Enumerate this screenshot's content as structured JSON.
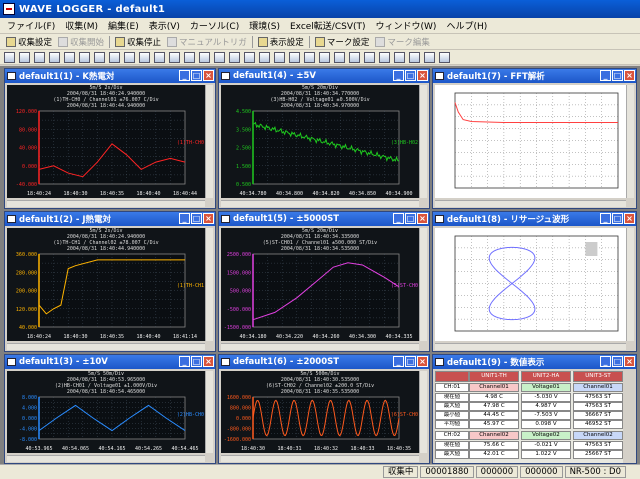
{
  "app": {
    "title": "WAVE LOGGER - default1"
  },
  "menu": [
    "ファイル(F)",
    "収集(M)",
    "編集(E)",
    "表示(V)",
    "カーソル(C)",
    "環境(S)",
    "Excel転送/CSV(T)",
    "ウィンドウ(W)",
    "ヘルプ(H)"
  ],
  "toolbar": [
    {
      "label": "収集設定",
      "enabled": true
    },
    {
      "label": "収集開始",
      "enabled": false
    },
    {
      "label": "収集停止",
      "enabled": true
    },
    {
      "label": "マニュアルトリガ",
      "enabled": false
    },
    {
      "label": "表示設定",
      "enabled": true
    },
    {
      "label": "マーク設定",
      "enabled": true
    },
    {
      "label": "マーク編集",
      "enabled": false
    }
  ],
  "windows": [
    {
      "title": "default1(1) - K熱電対",
      "kind": "trend",
      "color": "#ff2424",
      "header": [
        "5m/S  2s/Div",
        "2004/08/31 18:40:24.940000",
        "(1)TH-CH0 / Channel01 ±76.007 C/Div",
        "2004/08/31 18:40:44.940000"
      ],
      "xticks": [
        "18:40:24",
        "18:40:30",
        "18:40:35",
        "18:40:40",
        "18:40:44"
      ],
      "yticks": [
        "120.000",
        "80.000",
        "40.000",
        "0.000",
        "-40.000"
      ],
      "tag": "(1)TH-CH0"
    },
    {
      "title": "default1(4) - ±5V",
      "kind": "trend",
      "color": "#1fc81f",
      "header": [
        "5m/S  20m/Div",
        "2004/08/31 18:40:34.770000",
        "(3)HB-H02 / Voltage01 ±0.500V/Div",
        "2004/08/31 18:40:34.970000"
      ],
      "xticks": [
        "40:34.780",
        "40:34.800",
        "40:34.820",
        "40:34.850",
        "40:34.900"
      ],
      "yticks": [
        "4.500",
        "3.500",
        "2.500",
        "1.500",
        "0.500"
      ],
      "tag": "(3)HB-H02"
    },
    {
      "title": "default1(7) - FFT解析",
      "kind": "fft",
      "color": "#ff4040",
      "header": [],
      "xticks": [],
      "yticks": [],
      "tag": ""
    },
    {
      "title": "default1(2) - J熱電対",
      "kind": "trend",
      "color": "#ffb400",
      "header": [
        "5m/S  2s/Div",
        "2004/08/31 18:40:24.940000",
        "(1)TH-CH1 / Channel02 ±78.007 C/Div",
        "2004/08/31 18:40:44.940000"
      ],
      "xticks": [
        "18:40:24",
        "18:40:30",
        "18:40:35",
        "18:40:40",
        "18:41:14"
      ],
      "yticks": [
        "360.000",
        "280.000",
        "200.000",
        "120.000",
        "40.000"
      ],
      "tag": "(1)TH-CH1"
    },
    {
      "title": "default1(5) - ±5000ST",
      "kind": "trend",
      "color": "#e040e0",
      "header": [
        "5m/S  20m/Div",
        "2004/08/31 18:40:34.335000",
        "(5)ST-CH01 / Channel01 ±500.000 ST/Div",
        "2004/08/31 18:40:34.535000"
      ],
      "xticks": [
        "40:34.180",
        "40:34.220",
        "40:34.260",
        "40:34.300",
        "40:34.335"
      ],
      "yticks": [
        "2500.000",
        "1500.000",
        "500.000",
        "-500.000",
        "-1500.000"
      ],
      "tag": "(5)ST-CH0"
    },
    {
      "title": "default1(8) - リサージュ波形",
      "kind": "lissajous",
      "color": "#7070ff",
      "header": [],
      "xticks": [],
      "yticks": [],
      "tag": ""
    },
    {
      "title": "default1(3) - ±10V",
      "kind": "trend",
      "color": "#2a8cff",
      "header": [
        "5m/S  50m/Div",
        "2004/08/31 18:40:53.965000",
        "(2)HB-CH01 / Voltage01 ±1.000V/Div",
        "2004/08/31 18:40:54.465000"
      ],
      "xticks": [
        "40:53.965",
        "40:54.065",
        "40:54.165",
        "40:54.265",
        "40:54.465"
      ],
      "yticks": [
        "8.000",
        "4.000",
        "0.000",
        "-4.000",
        "-8.000"
      ],
      "tag": "(2)HB-CH0"
    },
    {
      "title": "default1(6) - ±2000ST",
      "kind": "trend",
      "color": "#ff5a1e",
      "header": [
        "5m/S  500m/Div",
        "2004/08/31 18:40:30.535000",
        "(6)ST-CH02 / Channel02 ±200.0 ST/Div",
        "2004/08/31 18:40:35.535000"
      ],
      "xticks": [
        "18:40:30",
        "18:40:31",
        "18:40:32",
        "18:40:33",
        "18:40:35"
      ],
      "yticks": [
        "1600.000",
        "800.000",
        "0.000",
        "-800.000",
        "-1600.000"
      ],
      "tag": "(6)ST-CH0"
    },
    {
      "title": "default1(9) - 数値表示",
      "kind": "numeric",
      "color": "#000",
      "header": [],
      "xticks": [],
      "yticks": [],
      "tag": ""
    }
  ],
  "numeric": {
    "units": [
      "UNIT1-TH",
      "UNIT2-HA",
      "UNIT3-ST"
    ],
    "group1": "CH:01",
    "group2": "CH:02",
    "rowlabels": [
      "現在値",
      "最大値",
      "最小値",
      "平均値"
    ],
    "chan1": [
      "Channel01",
      "Voltage01",
      "Channel01"
    ],
    "chan2": [
      "Channel02",
      "Voltage02",
      "Channel02"
    ],
    "vals1": [
      [
        "4.98 C",
        "-5.030 V",
        "47563 ST"
      ],
      [
        "47.98 C",
        "4.987 V",
        "47563 ST"
      ],
      [
        "44.45 C",
        "-7.503 V",
        "36667 ST"
      ],
      [
        "45.97 C",
        "0.098 V",
        "46952 ST"
      ]
    ],
    "vals2": [
      [
        "75.66 C",
        "-0.021 V",
        "47563 ST"
      ],
      [
        "42.01 C",
        "1.022 V",
        "25667 ST"
      ]
    ]
  },
  "status": {
    "state": "収集中",
    "count1": "00001880",
    "count2": "000000",
    "count3": "000000",
    "device": "NR-500 : D0"
  },
  "chart_data": [
    {
      "type": "line",
      "series": [
        {
          "name": "(1)TH-CH0",
          "color": "#ff2424",
          "x": [
            0,
            10,
            20,
            30,
            40,
            50,
            60,
            70,
            80,
            90,
            100
          ],
          "y": [
            20,
            25,
            15,
            10,
            30,
            55,
            40,
            20,
            30,
            35,
            30
          ]
        }
      ]
    },
    {
      "type": "line",
      "series": [
        {
          "name": "(3)HB-H02",
          "color": "#1fc81f",
          "x": [
            0,
            10,
            20,
            30,
            40,
            50,
            60,
            70,
            80,
            90,
            100
          ],
          "y": [
            82,
            80,
            76,
            70,
            64,
            56,
            50,
            46,
            40,
            36,
            38
          ]
        }
      ]
    },
    {
      "type": "line",
      "series": [
        {
          "name": "FFT",
          "color": "#ff4040",
          "x": [
            0,
            2,
            5,
            10,
            30,
            60,
            100
          ],
          "y": [
            90,
            80,
            72,
            70,
            69,
            69,
            69
          ]
        }
      ]
    },
    {
      "type": "line",
      "series": [
        {
          "name": "(1)TH-CH1",
          "color": "#ffb400",
          "x": [
            0,
            5,
            10,
            15,
            20,
            25,
            40,
            70,
            100
          ],
          "y": [
            30,
            18,
            25,
            30,
            80,
            84,
            92,
            92,
            92
          ]
        }
      ]
    },
    {
      "type": "line",
      "series": [
        {
          "name": "(5)ST-CH0",
          "color": "#e040e0",
          "x": [
            0,
            15,
            30,
            45,
            55,
            65,
            75,
            90,
            100
          ],
          "y": [
            10,
            20,
            40,
            65,
            82,
            88,
            85,
            68,
            55
          ]
        }
      ]
    },
    {
      "type": "scatter",
      "series": [
        {
          "name": "Lissajous",
          "color": "#7070ff",
          "x": [],
          "y": []
        }
      ]
    },
    {
      "type": "line",
      "series": [
        {
          "name": "(2)HB-CH0",
          "color": "#2a8cff",
          "x": [
            0,
            12,
            25,
            37,
            50,
            62,
            75,
            87,
            100
          ],
          "y": [
            20,
            50,
            80,
            50,
            20,
            50,
            80,
            50,
            20
          ]
        }
      ]
    },
    {
      "type": "line",
      "series": [
        {
          "name": "(6)ST-CH0",
          "color": "#ff5a1e",
          "x": [],
          "y": []
        }
      ]
    }
  ]
}
